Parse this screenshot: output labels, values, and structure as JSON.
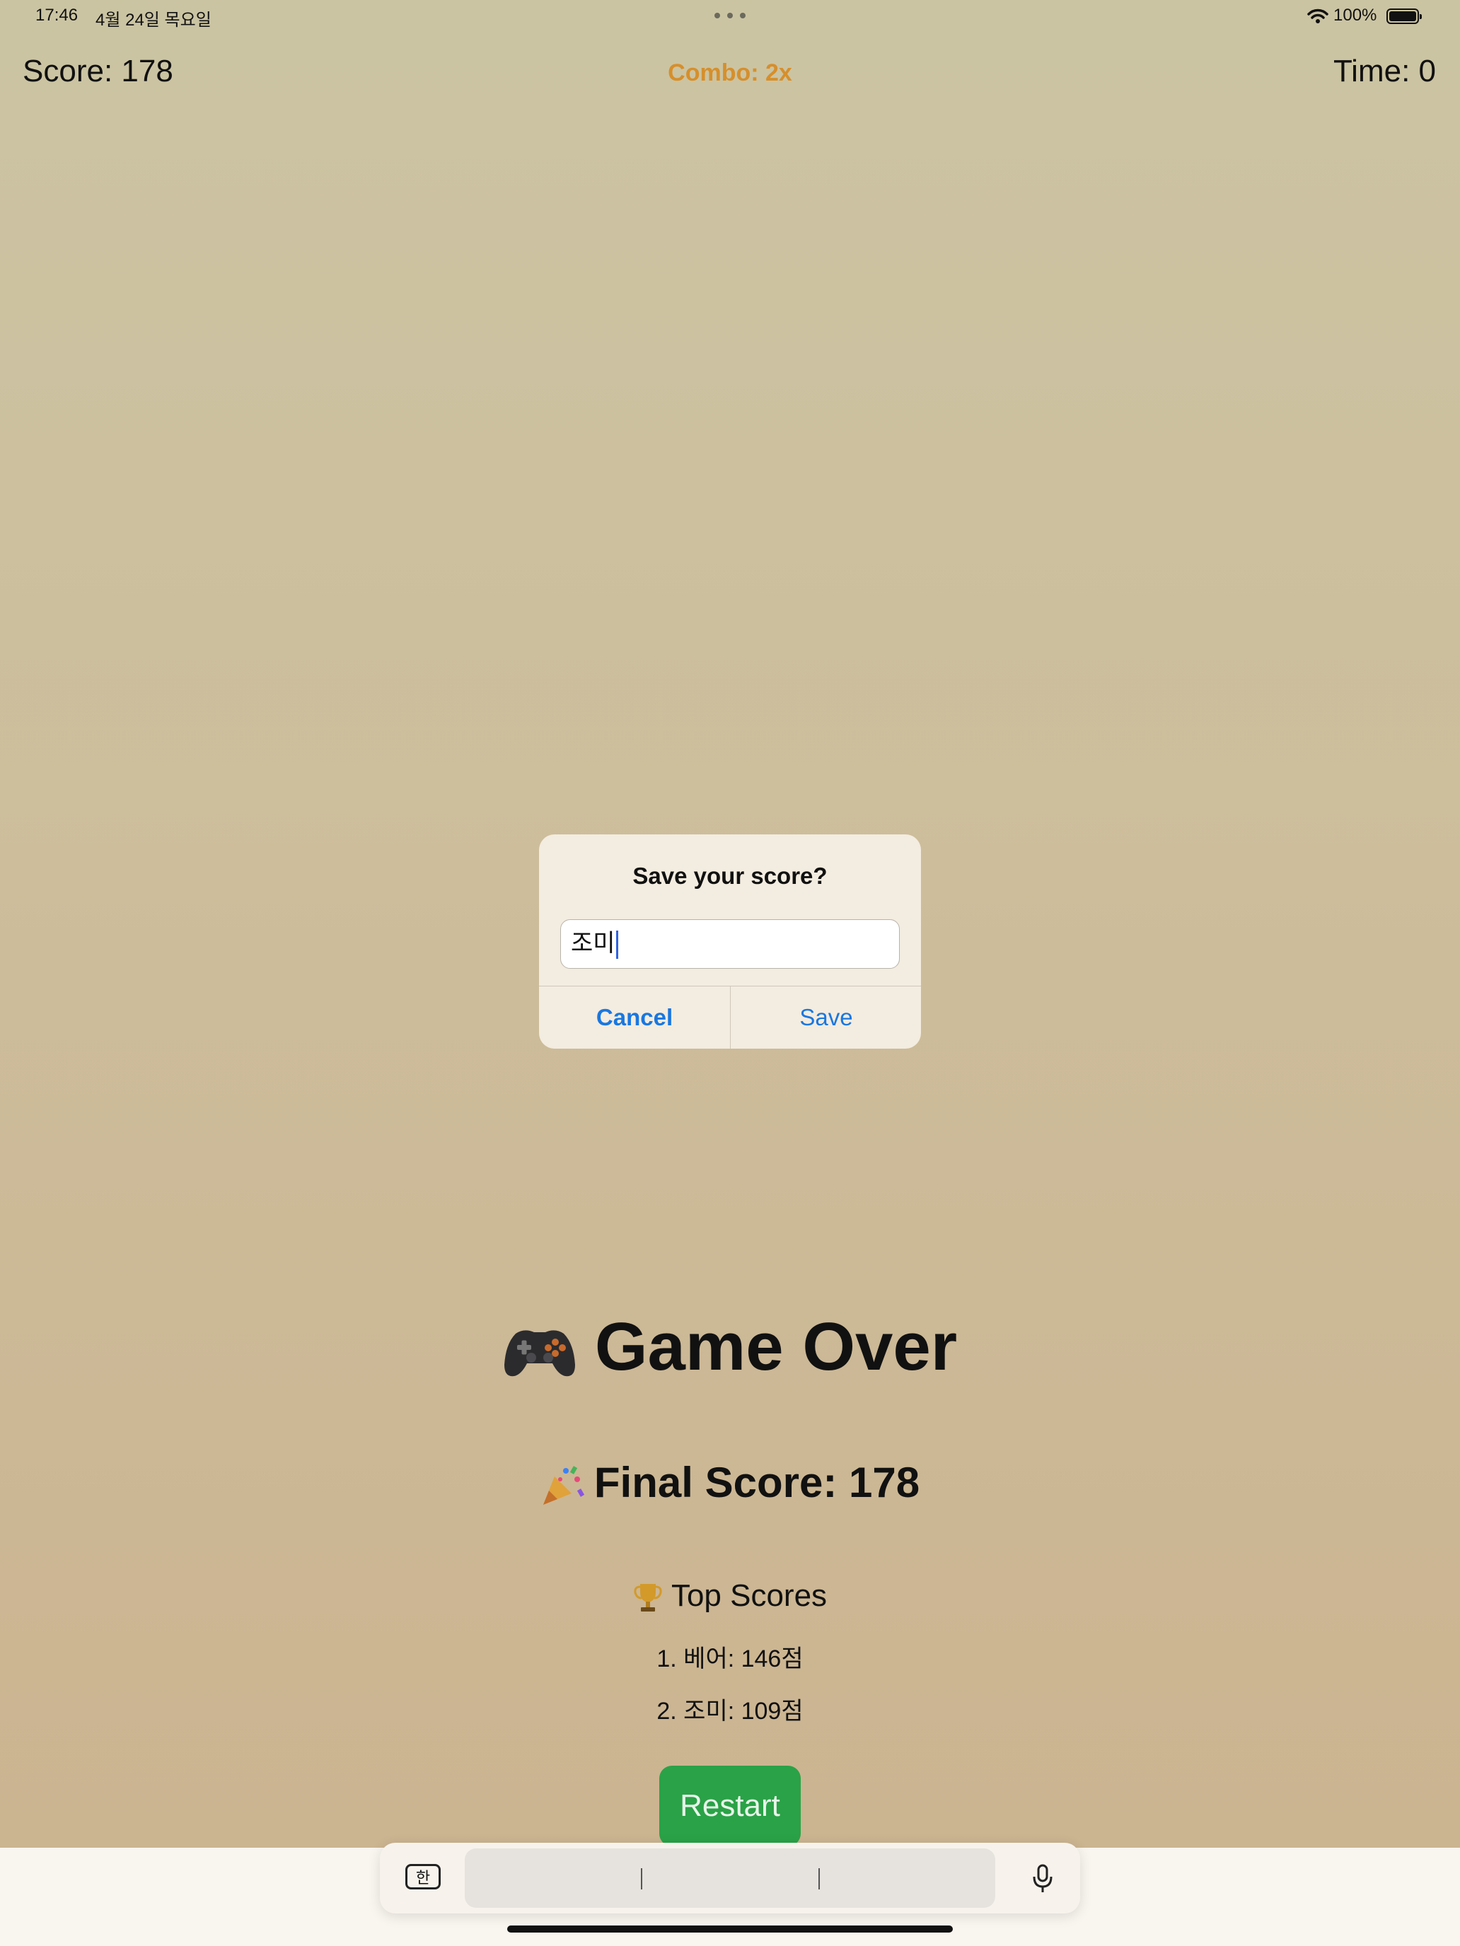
{
  "status_bar": {
    "time": "17:46",
    "date": "4월 24일 목요일",
    "battery_percent": "100%",
    "battery_level": 1.0,
    "icons": [
      "more-dots-icon",
      "wifi-icon",
      "battery-icon"
    ]
  },
  "hud": {
    "score": "Score: 178",
    "combo": "Combo: 2x",
    "time": "Time: 0"
  },
  "dialog": {
    "title": "Save your score?",
    "input_value": "조미",
    "cancel_label": "Cancel",
    "save_label": "Save"
  },
  "game_over": {
    "title": "Game Over",
    "title_icon": "game-controller-icon",
    "final_score": "Final Score: 178",
    "final_icon": "party-popper-icon",
    "top_scores_title": "Top Scores",
    "top_scores_icon": "trophy-icon",
    "top_scores": [
      {
        "text": "1. 베어: 146점"
      },
      {
        "text": "2. 조미: 109점"
      }
    ],
    "restart_label": "Restart"
  },
  "keyboard": {
    "language_key": "한",
    "icons": [
      "language-key-icon",
      "microphone-icon"
    ]
  },
  "colors": {
    "combo": "#d68f2b",
    "link_blue": "#1977e0",
    "restart_green": "#2aa247",
    "background_top": "#cbc4a3",
    "background_bottom": "#cbb38f"
  }
}
